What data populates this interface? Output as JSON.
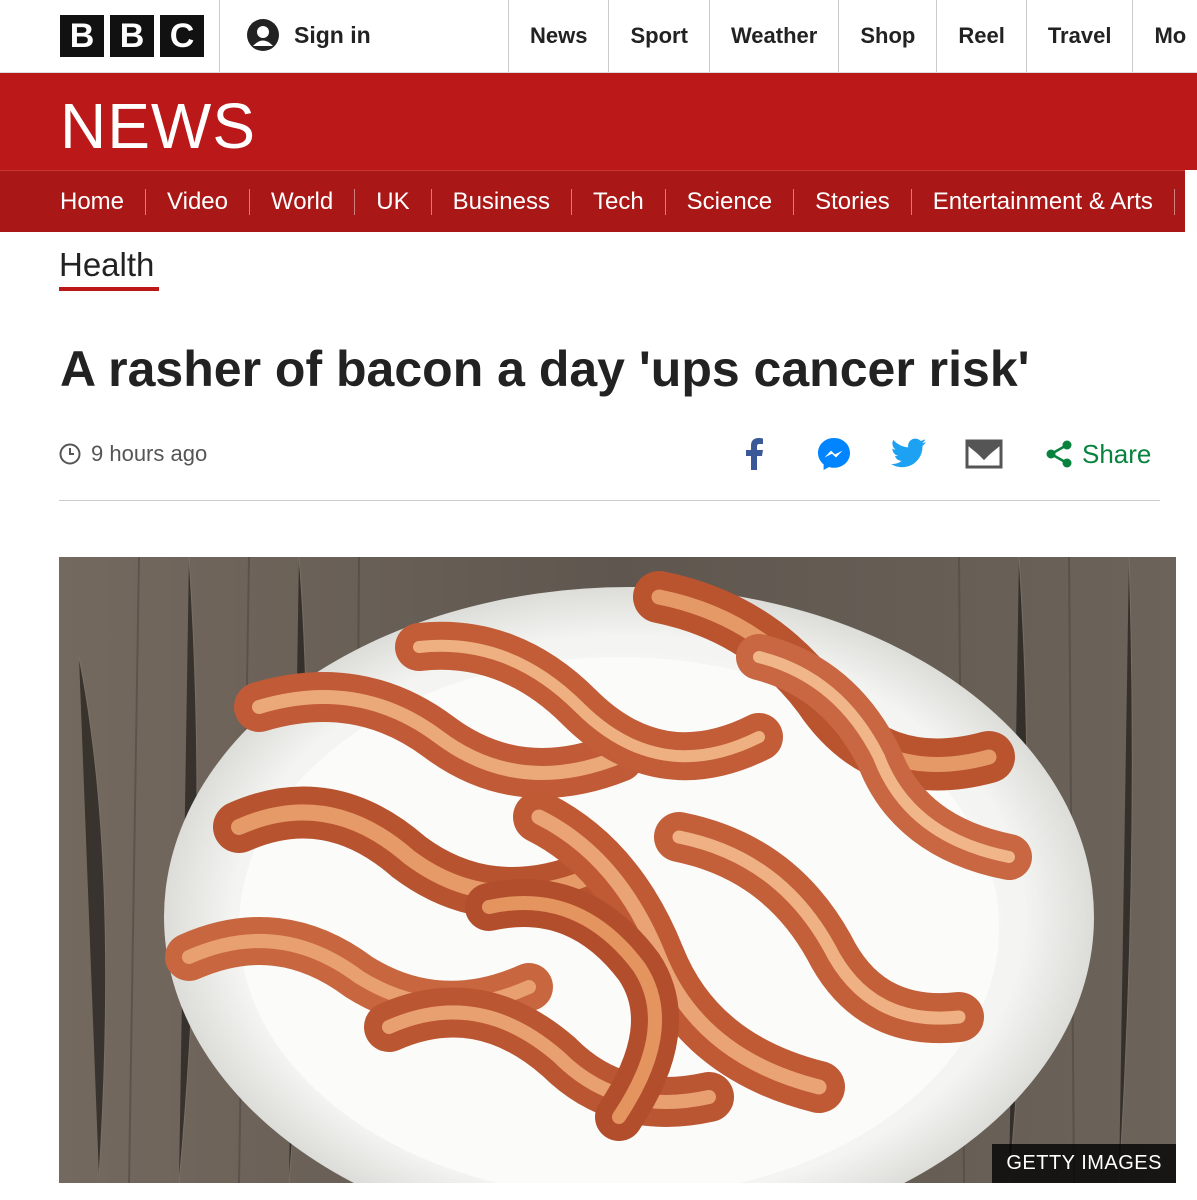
{
  "brand": {
    "logo_letters": [
      "B",
      "B",
      "C"
    ]
  },
  "account": {
    "sign_in_label": "Sign in",
    "icon": "user-icon"
  },
  "top_nav": [
    "News",
    "Sport",
    "Weather",
    "Shop",
    "Reel",
    "Travel",
    "Mo"
  ],
  "masthead": {
    "title": "NEWS",
    "color": "#bb1919"
  },
  "sub_nav": [
    "Home",
    "Video",
    "World",
    "UK",
    "Business",
    "Tech",
    "Science",
    "Stories",
    "Entertainment & Arts"
  ],
  "article": {
    "section": "Health",
    "headline": "A rasher of bacon a day 'ups cancer risk'",
    "timestamp": "9 hours ago",
    "share": {
      "icons": [
        "facebook-icon",
        "messenger-icon",
        "twitter-icon",
        "email-icon",
        "share-icon"
      ],
      "label": "Share"
    },
    "image": {
      "description": "plate of bacon",
      "credit": "GETTY IMAGES"
    }
  },
  "colors": {
    "accent": "#bb1919",
    "share_green": "#08833e"
  }
}
